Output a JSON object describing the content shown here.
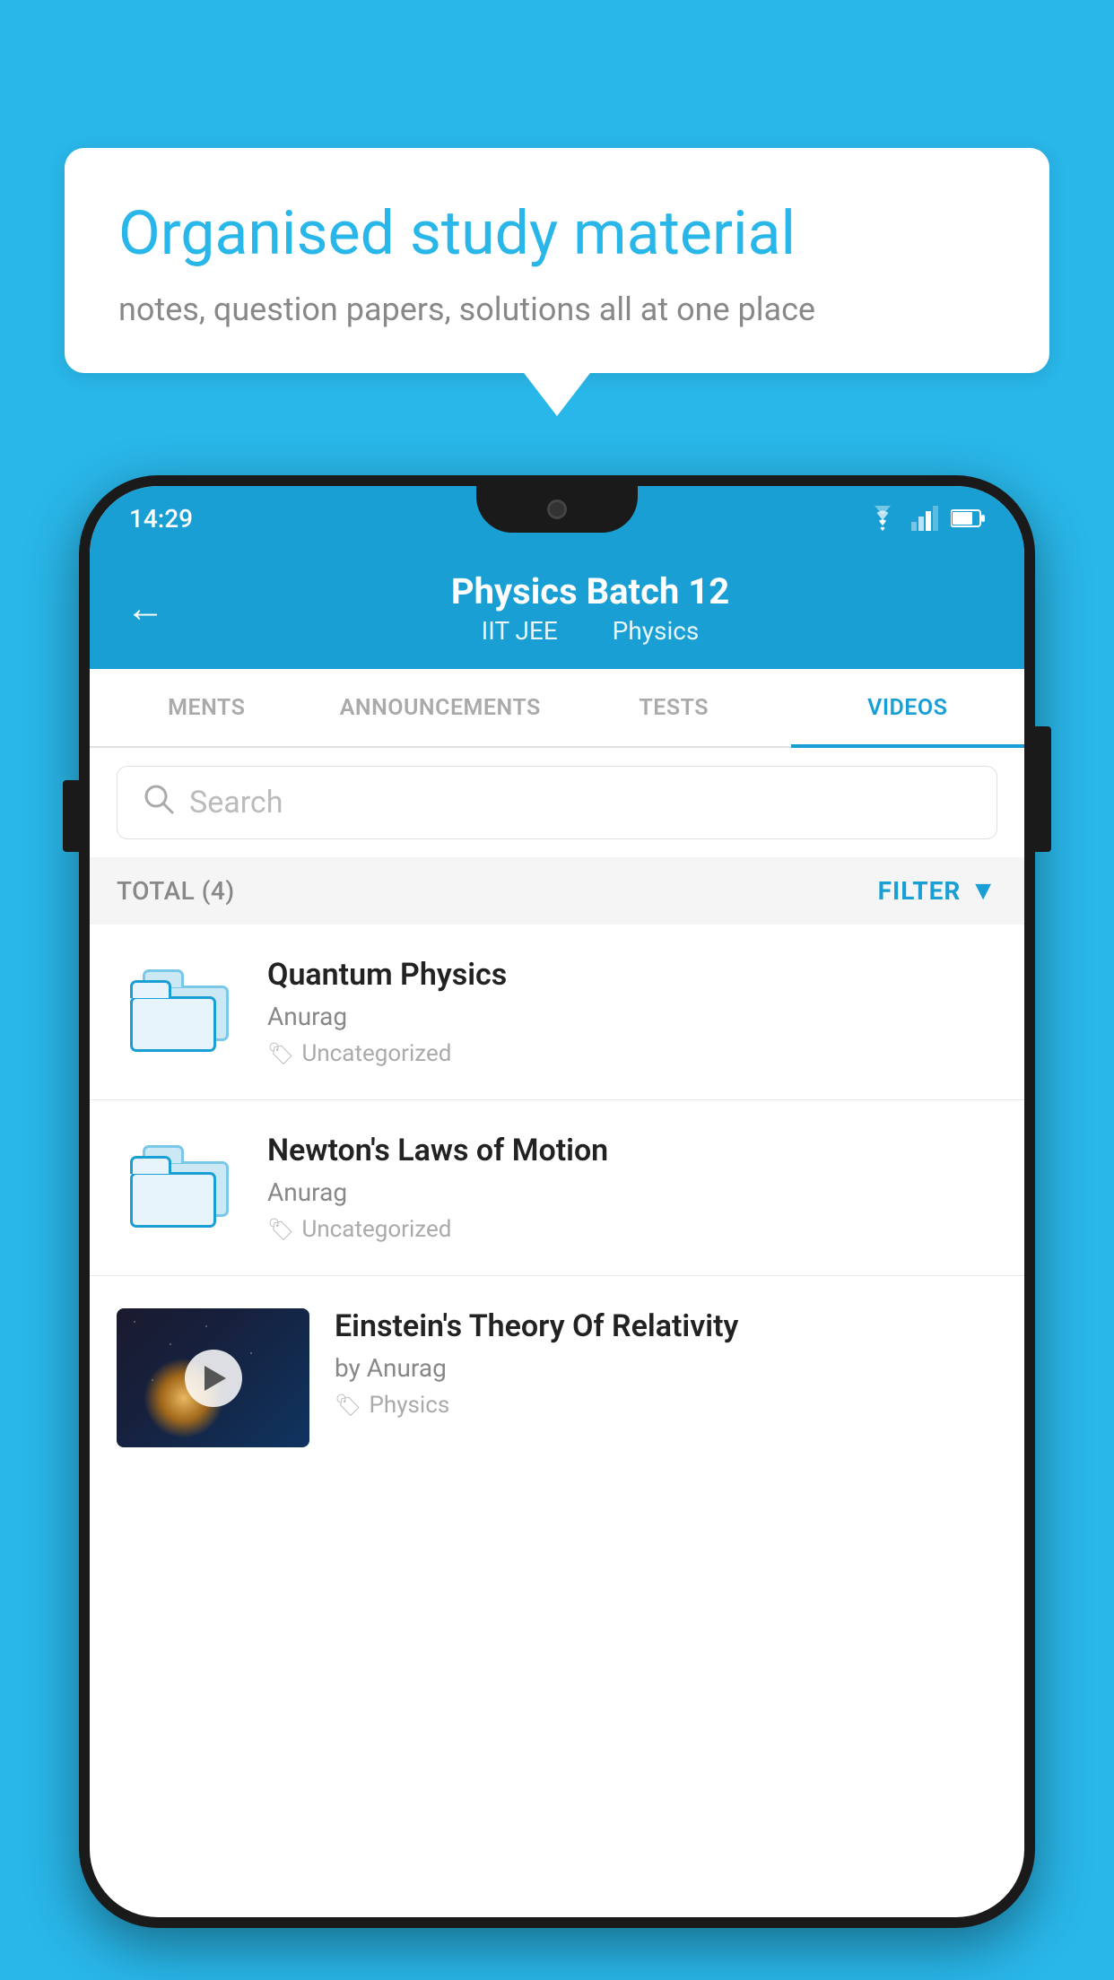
{
  "background": {
    "color": "#29b6e8"
  },
  "speech_bubble": {
    "title": "Organised study material",
    "subtitle": "notes, question papers, solutions all at one place"
  },
  "phone": {
    "status_bar": {
      "time": "14:29"
    },
    "header": {
      "back_label": "←",
      "title": "Physics Batch 12",
      "subtitle_left": "IIT JEE",
      "subtitle_right": "Physics"
    },
    "tabs": [
      {
        "label": "MENTS",
        "active": false
      },
      {
        "label": "ANNOUNCEMENTS",
        "active": false
      },
      {
        "label": "TESTS",
        "active": false
      },
      {
        "label": "VIDEOS",
        "active": true
      }
    ],
    "search": {
      "placeholder": "Search"
    },
    "filter_bar": {
      "total_label": "TOTAL (4)",
      "filter_label": "FILTER"
    },
    "videos": [
      {
        "id": 1,
        "title": "Quantum Physics",
        "author": "Anurag",
        "tag": "Uncategorized",
        "has_thumbnail": false
      },
      {
        "id": 2,
        "title": "Newton's Laws of Motion",
        "author": "Anurag",
        "tag": "Uncategorized",
        "has_thumbnail": false
      },
      {
        "id": 3,
        "title": "Einstein's Theory Of Relativity",
        "author": "by Anurag",
        "tag": "Physics",
        "has_thumbnail": true
      }
    ]
  }
}
